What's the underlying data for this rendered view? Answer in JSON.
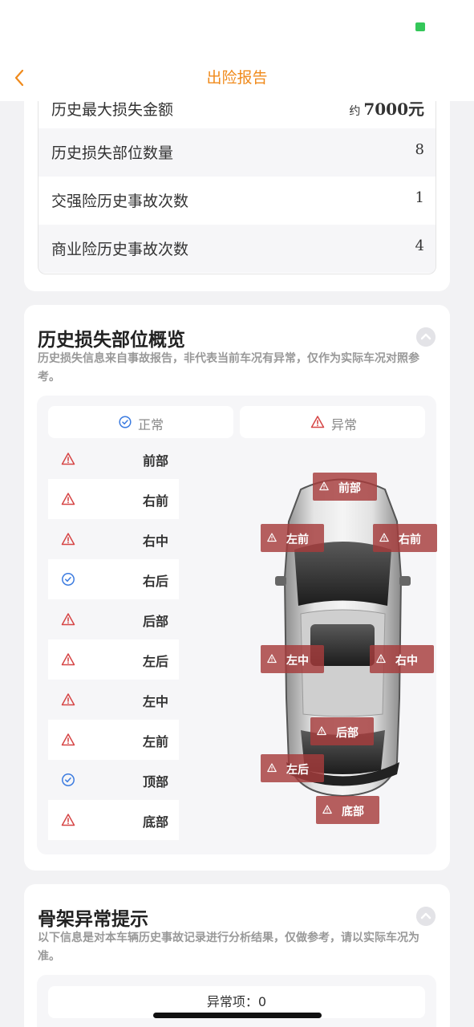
{
  "nav": {
    "title": "出险报告"
  },
  "summary_rows": [
    {
      "label": "历史最大损失金额",
      "prefix": "约",
      "value": "7000元"
    },
    {
      "label": "历史损失部位数量",
      "prefix": "",
      "value": "8"
    },
    {
      "label": "交强险历史事故次数",
      "prefix": "",
      "value": "1"
    },
    {
      "label": "商业险历史事故次数",
      "prefix": "",
      "value": "4"
    }
  ],
  "parts_overview": {
    "title": "历史损失部位概览",
    "subtitle": "历史损失信息来自事故报告，非代表当前车况有异常，仅作为实际车况对照参考。",
    "legend_normal": "正常",
    "legend_abnormal": "异常",
    "parts": [
      {
        "name": "前部",
        "status": "abnormal"
      },
      {
        "name": "右前",
        "status": "abnormal"
      },
      {
        "name": "右中",
        "status": "abnormal"
      },
      {
        "name": "右后",
        "status": "normal"
      },
      {
        "name": "后部",
        "status": "abnormal"
      },
      {
        "name": "左后",
        "status": "abnormal"
      },
      {
        "name": "左中",
        "status": "abnormal"
      },
      {
        "name": "左前",
        "status": "abnormal"
      },
      {
        "name": "顶部",
        "status": "normal"
      },
      {
        "name": "底部",
        "status": "abnormal"
      }
    ],
    "car_tags": [
      "前部",
      "左前",
      "右前",
      "左中",
      "右中",
      "后部",
      "左后",
      "底部"
    ]
  },
  "frame_section": {
    "title": "骨架异常提示",
    "subtitle": "以下信息是对本车辆历史事故记录进行分析结果，仅做参考，请以实际车况为准。",
    "abnormal_count": "异常项：0"
  },
  "colors": {
    "accent": "#f08a1b",
    "warning": "#d64545",
    "normal": "#3b7be0",
    "tag_bg": "#a63c3c"
  }
}
